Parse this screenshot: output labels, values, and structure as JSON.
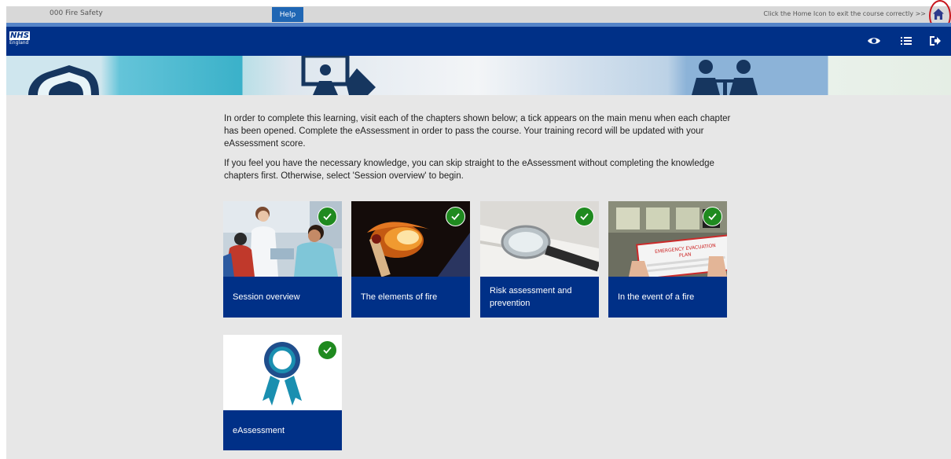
{
  "topbar": {
    "course_title": "000 Fire Safety",
    "help_label": "Help",
    "home_hint": "Click the Home Icon to exit the course correctly >>"
  },
  "header": {
    "logo_text": "NHS",
    "logo_sub": "England",
    "icons": [
      "eye-icon",
      "list-icon",
      "exit-icon"
    ]
  },
  "intro": {
    "paragraph_1": "In order to complete this learning, visit each of the chapters shown below; a tick appears on the main menu when each chapter has been opened. Complete the eAssessment in order to pass the course. Your training record will be updated with your eAssessment score.",
    "paragraph_2": "If you feel you have the necessary knowledge, you can skip straight to the eAssessment without completing the knowledge chapters first. Otherwise, select 'Session overview' to begin."
  },
  "chapters": [
    {
      "label": "Session overview",
      "completed": true
    },
    {
      "label": "The elements of fire",
      "completed": true
    },
    {
      "label": "Risk assessment and prevention",
      "completed": true
    },
    {
      "label": "In the event of a fire",
      "completed": true
    },
    {
      "label": "eAssessment",
      "completed": true
    }
  ],
  "evacuation_sign": {
    "line1": "EMERGENCY EVACUATION",
    "line2": "PLAN"
  },
  "colors": {
    "nhs_blue": "#003087",
    "help_blue": "#1f66b4",
    "tick_green": "#1f8a1f",
    "background": "#e7e7e7",
    "highlight_red": "#c8161d"
  }
}
